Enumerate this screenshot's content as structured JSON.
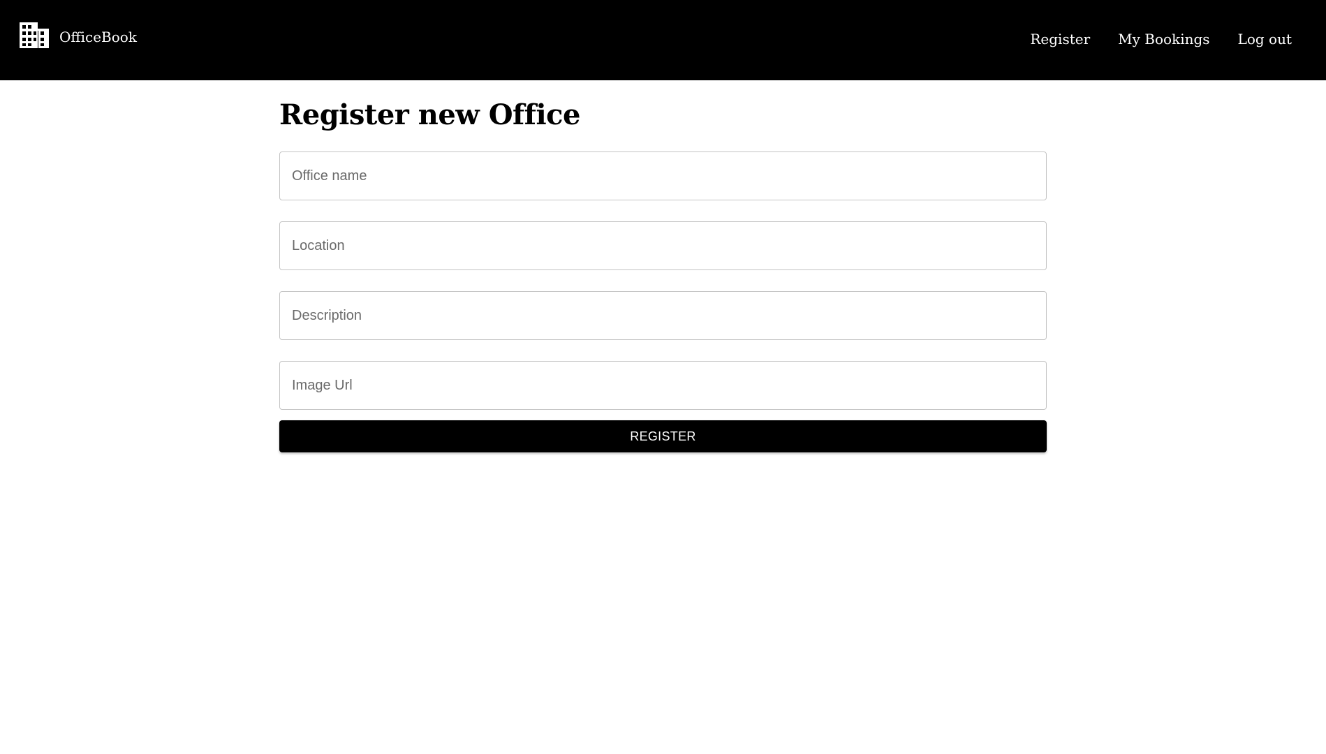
{
  "navbar": {
    "brand_icon": "office-building-icon",
    "brand_name": "OfficeBook",
    "links": [
      {
        "label": "Register"
      },
      {
        "label": "My Bookings"
      },
      {
        "label": "Log out"
      }
    ]
  },
  "form": {
    "title": "Register new Office",
    "fields": [
      {
        "placeholder": "Office name",
        "value": ""
      },
      {
        "placeholder": "Location",
        "value": ""
      },
      {
        "placeholder": "Description",
        "value": ""
      },
      {
        "placeholder": "Image Url",
        "value": ""
      }
    ],
    "submit_label": "REGISTER"
  },
  "colors": {
    "navbar_bg": "#000000",
    "button_bg": "#000000",
    "button_text": "#ffffff",
    "field_border": "#c4c4c4"
  }
}
